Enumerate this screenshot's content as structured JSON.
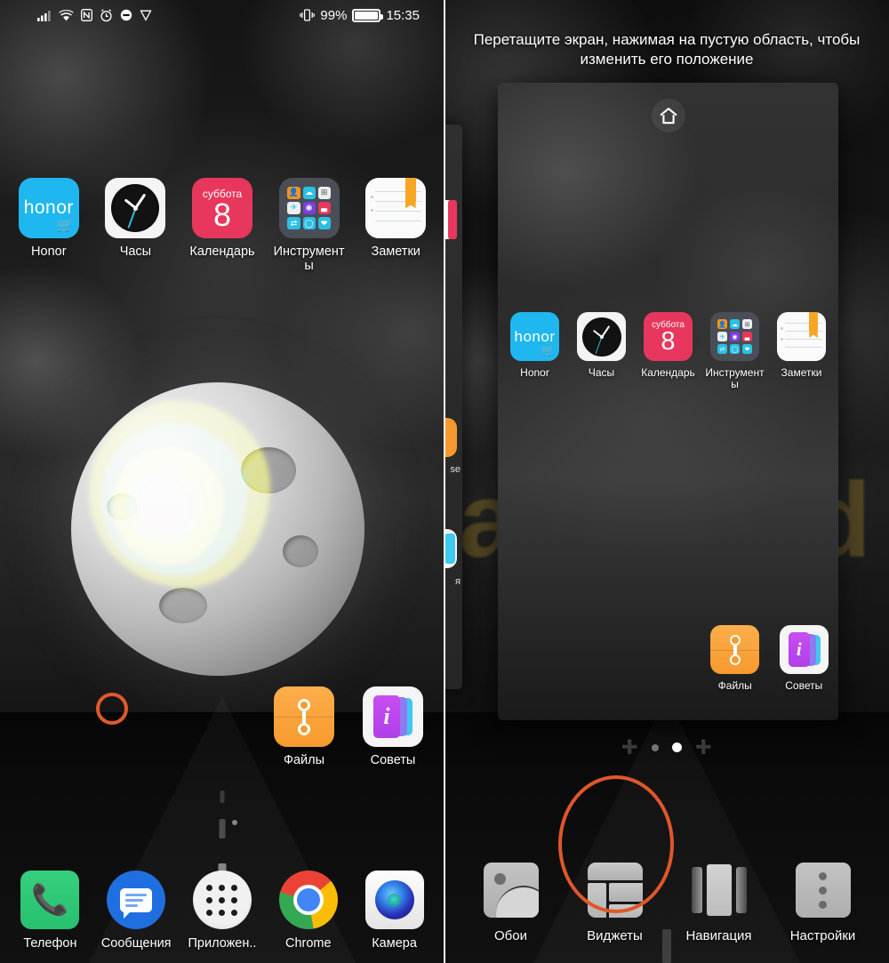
{
  "meta": {
    "accent_orange": "#e0572a",
    "honor_blue": "#1fb7ef",
    "calendar_red": "#e8375c"
  },
  "status_bar": {
    "time": "15:35",
    "battery_percent": "99%",
    "icons": [
      "signal-icon",
      "wifi-icon",
      "nfc-icon",
      "alarm-icon",
      "do-not-disturb-icon",
      "play-icon",
      "vibrate-icon",
      "battery-icon"
    ]
  },
  "left_screen": {
    "name": "home-screen",
    "apps_row": [
      {
        "label": "Honor",
        "icon": "honor-icon",
        "brand_text": "honor"
      },
      {
        "label": "Часы",
        "icon": "clock-icon"
      },
      {
        "label": "Календарь",
        "icon": "calendar-icon",
        "weekday": "суббота",
        "day": "8"
      },
      {
        "label": "Инструменты",
        "icon": "tools-folder-icon"
      },
      {
        "label": "Заметки",
        "icon": "notes-icon"
      }
    ],
    "mid_apps": [
      {
        "label": "Файлы",
        "icon": "files-icon"
      },
      {
        "label": "Советы",
        "icon": "tips-icon",
        "glyph": "i"
      }
    ],
    "dock": [
      {
        "label": "Телефон",
        "icon": "phone-icon"
      },
      {
        "label": "Сообщения",
        "icon": "messages-icon"
      },
      {
        "label": "Приложен..",
        "icon": "app-drawer-icon"
      },
      {
        "label": "Chrome",
        "icon": "chrome-icon"
      },
      {
        "label": "Камера",
        "icon": "camera-icon"
      }
    ]
  },
  "right_screen": {
    "name": "home-screen-edit-mode",
    "hint": "Перетащите экран, нажимая на пустую область, чтобы изменить его положение",
    "card": {
      "home_indicator_icon": "home-icon",
      "apps_row": [
        {
          "label": "Honor",
          "icon": "honor-icon",
          "brand_text": "honor"
        },
        {
          "label": "Часы",
          "icon": "clock-icon"
        },
        {
          "label": "Календарь",
          "icon": "calendar-icon",
          "weekday": "суббота",
          "day": "8"
        },
        {
          "label": "Инструменты",
          "icon": "tools-folder-icon"
        },
        {
          "label": "Заметки",
          "icon": "notes-icon"
        }
      ],
      "mid_apps": [
        {
          "label": "Файлы",
          "icon": "files-icon"
        },
        {
          "label": "Советы",
          "icon": "tips-icon",
          "glyph": "i"
        }
      ]
    },
    "page_indicator": {
      "items": [
        "add-page-plus",
        "page-dot",
        "page-dot-active",
        "add-page-plus"
      ],
      "active_index": 2
    },
    "toolbar": [
      {
        "label": "Обои",
        "icon": "wallpaper-icon",
        "highlighted": false
      },
      {
        "label": "Виджеты",
        "icon": "widgets-icon",
        "highlighted": true
      },
      {
        "label": "Навигация",
        "icon": "navigation-icon",
        "highlighted": false
      },
      {
        "label": "Настройки",
        "icon": "settings-icon",
        "highlighted": false
      }
    ]
  }
}
